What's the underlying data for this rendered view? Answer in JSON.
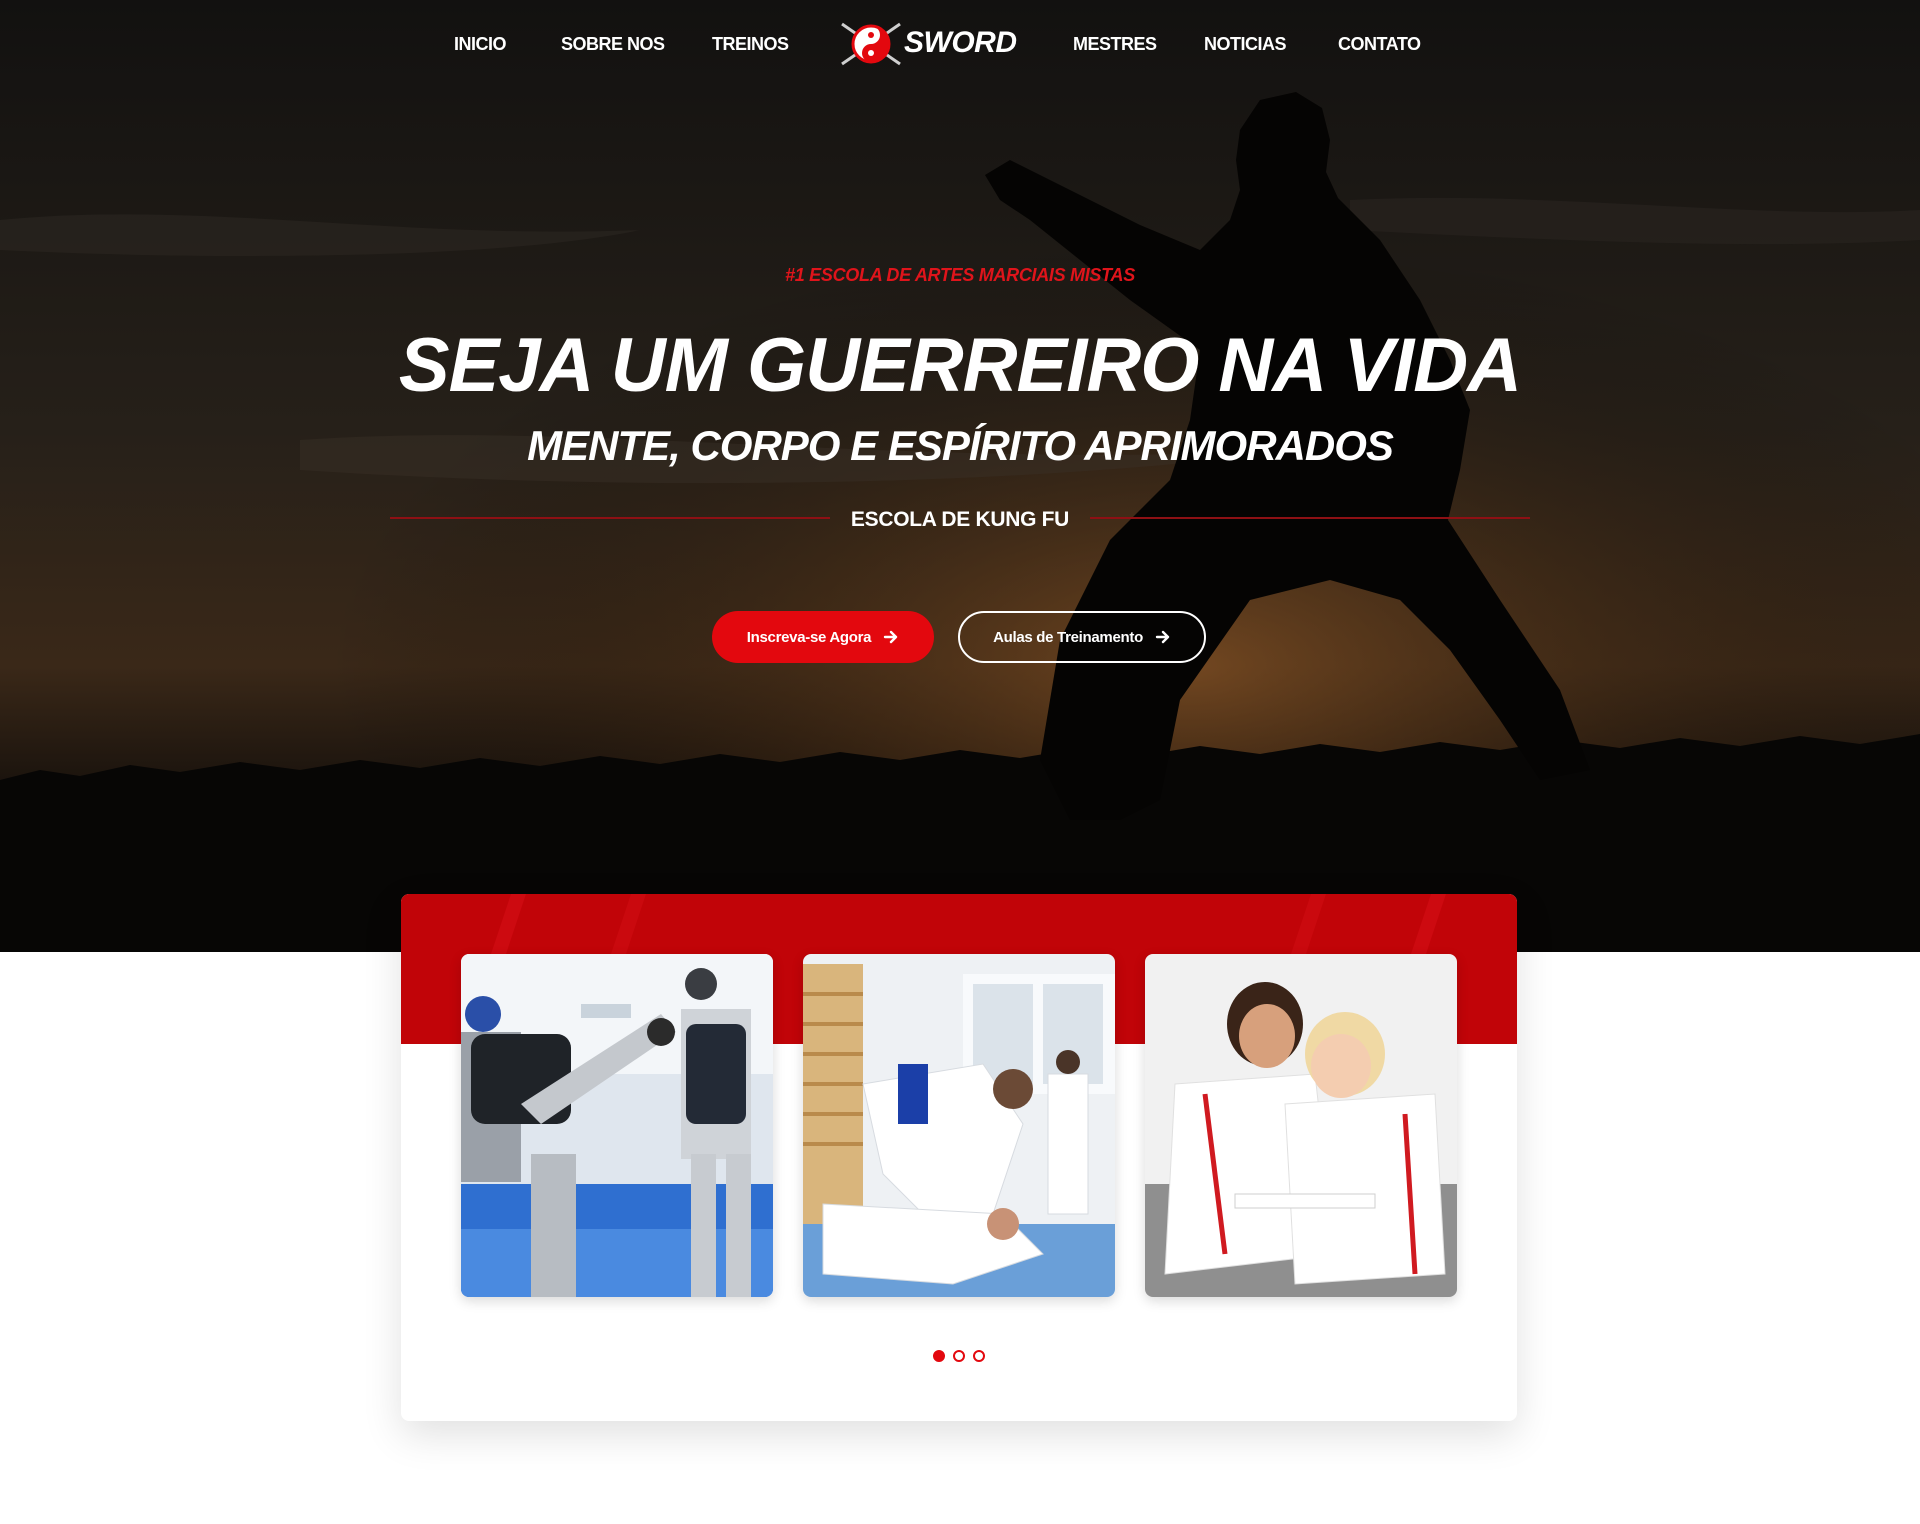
{
  "nav": {
    "items": [
      {
        "label": "INICIO"
      },
      {
        "label": "SOBRE NOS"
      },
      {
        "label": "TREINOS"
      },
      {
        "label": "MESTRES"
      },
      {
        "label": "NOTICIAS"
      },
      {
        "label": "CONTATO"
      }
    ],
    "logo_text": "SWORD"
  },
  "hero": {
    "eyebrow": "#1 ESCOLA DE ARTES MARCIAIS MISTAS",
    "headline": "SEJA UM GUERREIRO NA VIDA",
    "subheadline": "MENTE, CORPO E ESPÍRITO APRIMORADOS",
    "school_label": "ESCOLA DE KUNG FU",
    "primary_button": "Inscreva-se Agora",
    "secondary_button": "Aulas de Treinamento"
  },
  "slider": {
    "slides": [
      {
        "image": "taekwondo-kick-photo"
      },
      {
        "image": "judo-throw-photo"
      },
      {
        "image": "kids-jiu-jitsu-hug-photo"
      }
    ],
    "dots": 3,
    "active_dot": 1
  },
  "colors": {
    "accent": "#e3080e",
    "band": "#c70509",
    "hero_dark": "#111010"
  },
  "icons": {
    "arrow": "arrow-right-icon",
    "logo": "yin-yang-sword-icon"
  }
}
